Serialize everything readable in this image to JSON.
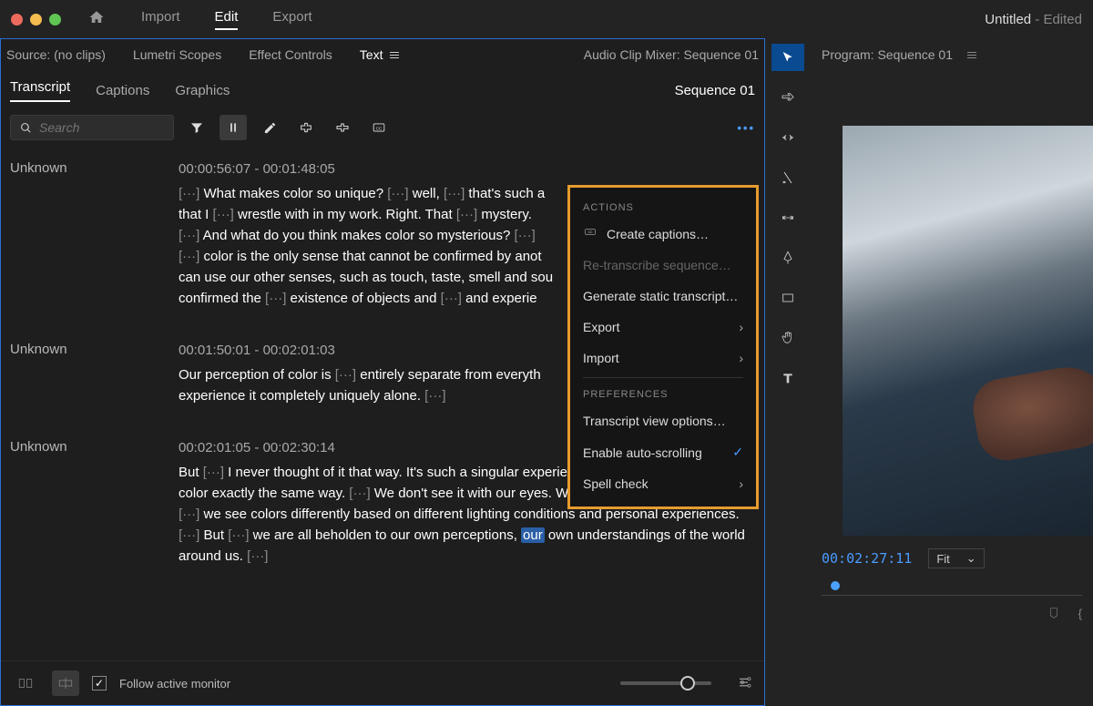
{
  "topbar": {
    "tabs": [
      "Import",
      "Edit",
      "Export"
    ],
    "active_tab": "Edit",
    "title": "Untitled",
    "edited": " - Edited"
  },
  "panel_tabs": {
    "source": "Source: (no clips)",
    "lumetri": "Lumetri Scopes",
    "effect": "Effect Controls",
    "text": "Text",
    "audio": "Audio Clip Mixer: Sequence 01"
  },
  "subtabs": {
    "items": [
      "Transcript",
      "Captions",
      "Graphics"
    ],
    "active": "Transcript",
    "sequence": "Sequence 01"
  },
  "search": {
    "placeholder": "Search"
  },
  "transcript": [
    {
      "speaker": "Unknown",
      "time": "00:00:56:07 - 00:01:48:05",
      "text": "[···] What makes color so unique? [···] well, [···] that's such a [···] that I [···] wrestle with in my work. Right. That [···] mystery. [···] And what do you think makes color so mysterious? [···] [···] color is the only sense that cannot be confirmed by another sense. We can use our other senses, such as touch, taste, smell and sound. We've [···] confirmed the [···] existence of objects and [···] and experience."
    },
    {
      "speaker": "Unknown",
      "time": "00:01:50:01 - 00:02:01:03",
      "text": "Our perception of color is [···] entirely separate from everything else. So we experience it completely uniquely alone. [···]"
    },
    {
      "speaker": "Unknown",
      "time": "00:02:01:05 - 00:02:30:14",
      "text": "But [···] I never thought of it that way. It's such a singular experience, Right. And no one sees color exactly the same way. [···] We don't see it with our eyes. We we see with our brains. And [···] we see colors differently based on different lighting conditions and personal experiences. [···] But [···] we are all beholden to our own perceptions, our own understandings of the world around us. [···]"
    }
  ],
  "dropdown": {
    "hdr1": "ACTIONS",
    "create_captions": "Create captions…",
    "retranscribe": "Re-transcribe sequence…",
    "static": "Generate static transcript…",
    "export": "Export",
    "import": "Import",
    "hdr2": "PREFERENCES",
    "viewopts": "Transcript view options…",
    "autoscroll": "Enable auto-scrolling",
    "spellcheck": "Spell check"
  },
  "footer": {
    "follow": "Follow active monitor"
  },
  "program": {
    "header": "Program: Sequence 01",
    "timecode": "00:02:27:11",
    "fit": "Fit"
  }
}
